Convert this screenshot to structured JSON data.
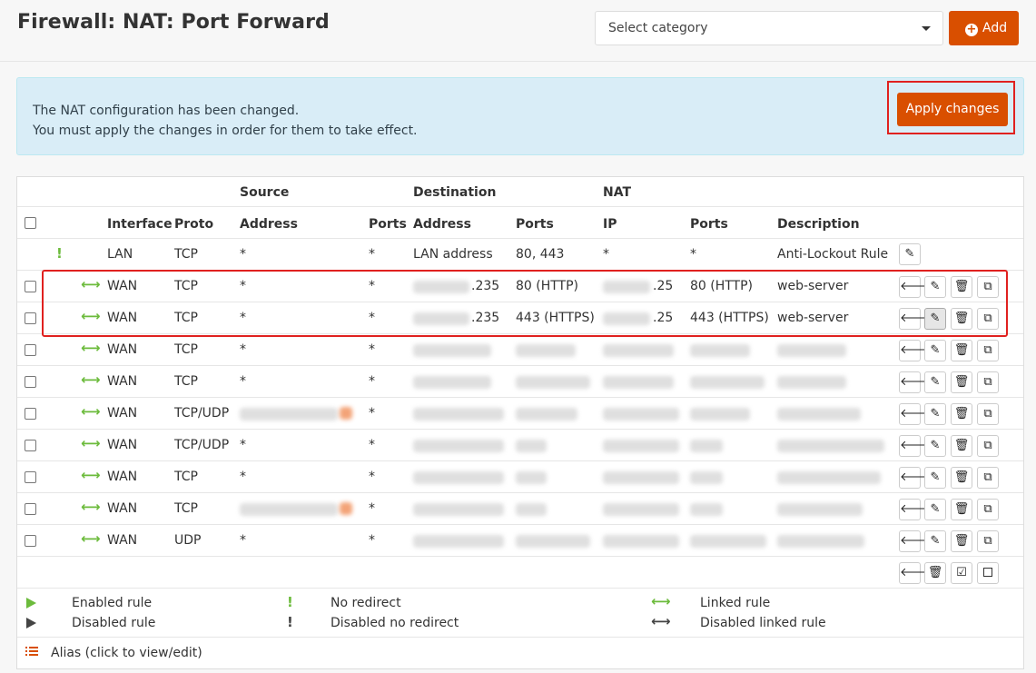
{
  "page": {
    "title": "Firewall: NAT: Port Forward",
    "category_placeholder": "Select category",
    "add_label": "Add"
  },
  "alert": {
    "line1": "The NAT configuration has been changed.",
    "line2": "You must apply the changes in order for them to take effect.",
    "apply_label": "Apply changes"
  },
  "table": {
    "groups": {
      "source": "Source",
      "destination": "Destination",
      "nat": "NAT"
    },
    "columns": {
      "interface": "Interface",
      "proto": "Proto",
      "src_address": "Address",
      "src_ports": "Ports",
      "dst_address": "Address",
      "dst_ports": "Ports",
      "nat_ip": "IP",
      "nat_ports": "Ports",
      "description": "Description"
    },
    "rows": [
      {
        "interface": "LAN",
        "proto": "TCP",
        "src_address": "*",
        "src_ports": "*",
        "dst_address": "LAN address",
        "dst_ports": "80, 443",
        "nat_ip": "*",
        "nat_ports": "*",
        "description": "Anti-Lockout Rule"
      },
      {
        "interface": "WAN",
        "proto": "TCP",
        "src_address": "*",
        "src_ports": "*",
        "dst_address": ".235",
        "dst_ports": "80 (HTTP)",
        "nat_ip": ".25",
        "nat_ports": "80 (HTTP)",
        "description": "web-server"
      },
      {
        "interface": "WAN",
        "proto": "TCP",
        "src_address": "*",
        "src_ports": "*",
        "dst_address": ".235",
        "dst_ports": "443 (HTTPS)",
        "nat_ip": ".25",
        "nat_ports": "443 (HTTPS)",
        "description": "web-server"
      },
      {
        "interface": "WAN",
        "proto": "TCP",
        "src_address": "*",
        "src_ports": "*"
      },
      {
        "interface": "WAN",
        "proto": "TCP",
        "src_address": "*",
        "src_ports": "*"
      },
      {
        "interface": "WAN",
        "proto": "TCP/UDP",
        "src_address": "",
        "src_ports": "*"
      },
      {
        "interface": "WAN",
        "proto": "TCP/UDP",
        "src_address": "*",
        "src_ports": "*"
      },
      {
        "interface": "WAN",
        "proto": "TCP",
        "src_address": "*",
        "src_ports": "*"
      },
      {
        "interface": "WAN",
        "proto": "TCP",
        "src_address": "",
        "src_ports": "*"
      },
      {
        "interface": "WAN",
        "proto": "UDP",
        "src_address": "*",
        "src_ports": "*"
      }
    ]
  },
  "legend": {
    "enabled_rule": "Enabled rule",
    "disabled_rule": "Disabled rule",
    "no_redirect": "No redirect",
    "disabled_no_redirect": "Disabled no redirect",
    "linked_rule": "Linked rule",
    "disabled_linked_rule": "Disabled linked rule",
    "alias": "Alias (click to view/edit)"
  },
  "icons": {
    "excl": "!",
    "linked": "⟷",
    "left_arrow": "🡐",
    "pencil": "✎",
    "trash": "🗑",
    "copy": "⧉",
    "check": "☑"
  },
  "colors": {
    "accent": "#d94f00",
    "enabled": "#6cbb3c",
    "alert_bg": "#d9edf7",
    "highlight": "#e0211f"
  }
}
